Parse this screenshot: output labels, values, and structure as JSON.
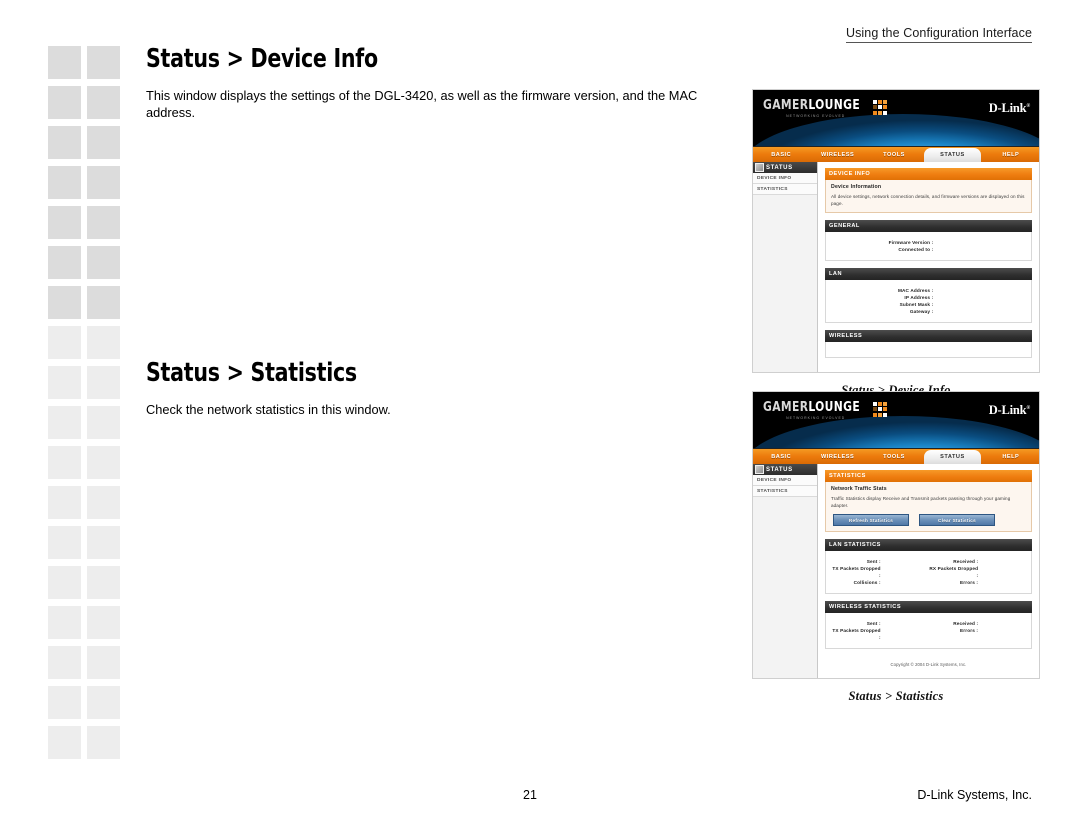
{
  "page": {
    "running_head": "Using the Configuration Interface",
    "page_number": "21",
    "footer_company": "D-Link Systems, Inc."
  },
  "sections": [
    {
      "title": "Status > Device Info",
      "body": "This window displays the settings of the DGL-3420, as well as the firmware version, and the MAC address.",
      "figure_caption": "Status > Device Info"
    },
    {
      "title": "Status > Statistics",
      "body": "Check the network statistics in this window.",
      "figure_caption": "Status > Statistics"
    }
  ],
  "router_ui": {
    "brand": {
      "logo_primary": "GAMER",
      "logo_secondary": "LOUNGE",
      "logo_tagline": "NETWORKING EVOLVED",
      "vendor": "D-Link",
      "vendor_mark": "®"
    },
    "nav_tabs": [
      {
        "label": "BASIC",
        "active": false
      },
      {
        "label": "WIRELESS",
        "active": false
      },
      {
        "label": "TOOLS",
        "active": false
      },
      {
        "label": "STATUS",
        "active": true
      },
      {
        "label": "HELP",
        "active": false
      }
    ],
    "sidebar": {
      "header": "STATUS",
      "items": [
        {
          "label": "DEVICE INFO"
        },
        {
          "label": "STATISTICS"
        }
      ]
    },
    "copyright": "Copyright © 2004 D-Link Systems, Inc.",
    "colors": {
      "accent_orange": "#ee7d10",
      "panel_dark": "#2e2e2e",
      "button_blue": "#4f78a6",
      "banner_black": "#000000",
      "wave_blue": "#1b86c8"
    }
  },
  "device_info_page": {
    "panel_title": "DEVICE INFO",
    "subtitle": "Device Information",
    "description": "All device settings, network connection details, and firmware versions are displayed on this page.",
    "general": {
      "title": "GENERAL",
      "fields": [
        {
          "label": "Firmware Version :",
          "value": ""
        },
        {
          "label": "Connected to :",
          "value": ""
        }
      ]
    },
    "lan": {
      "title": "LAN",
      "fields": [
        {
          "label": "MAC Address :",
          "value": ""
        },
        {
          "label": "IP Address :",
          "value": ""
        },
        {
          "label": "Subnet Mask :",
          "value": ""
        },
        {
          "label": "Gateway :",
          "value": ""
        }
      ]
    },
    "wireless": {
      "title": "WIRELESS"
    }
  },
  "statistics_page": {
    "panel_title": "STATISTICS",
    "subtitle": "Network Traffic Stats",
    "description": "Traffic Statistics display Receive and Transmit packets passing through your gaming adapter.",
    "buttons": [
      {
        "label": "Refresh Statistics"
      },
      {
        "label": "Clear Statistics"
      }
    ],
    "lan_statistics": {
      "title": "LAN STATISTICS",
      "rows": [
        {
          "left_label": "Sent :",
          "left_value": "",
          "right_label": "Received :",
          "right_value": ""
        },
        {
          "left_label": "TX Packets Dropped :",
          "left_value": "",
          "right_label": "RX Packets Dropped :",
          "right_value": ""
        },
        {
          "left_label": "Collisions :",
          "left_value": "",
          "right_label": "Errors :",
          "right_value": ""
        }
      ]
    },
    "wireless_statistics": {
      "title": "WIRELESS STATISTICS",
      "rows": [
        {
          "left_label": "Sent :",
          "left_value": "",
          "right_label": "Received :",
          "right_value": ""
        },
        {
          "left_label": "TX Packets Dropped :",
          "left_value": "",
          "right_label": "Errors :",
          "right_value": ""
        }
      ]
    }
  }
}
